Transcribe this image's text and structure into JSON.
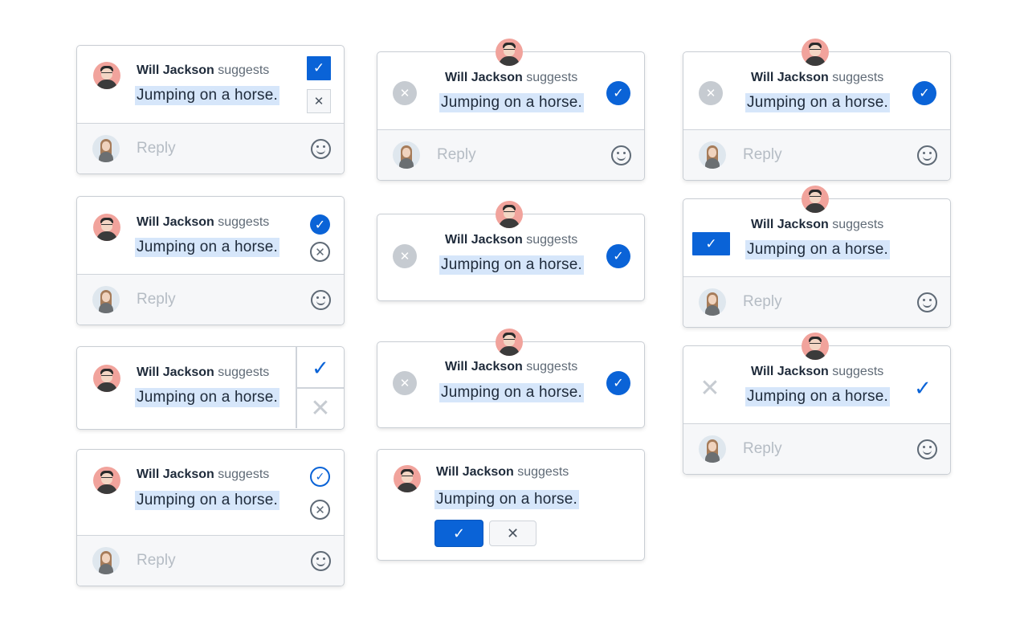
{
  "suggestion": {
    "author": "Will Jackson",
    "verb": "suggests",
    "text": "Jumping on a horse."
  },
  "reply": {
    "placeholder": "Reply"
  },
  "icons": {
    "accept": "check-icon",
    "reject": "close-icon",
    "emoji": "smiley-icon",
    "author_avatar": "avatar-man-glasses",
    "user_avatar": "avatar-woman"
  },
  "glyphs": {
    "check": "✓",
    "x": "✕"
  },
  "colors": {
    "accent": "#0a63d7",
    "highlight": "#d6e6fa",
    "muted": "#c6cbd1"
  }
}
